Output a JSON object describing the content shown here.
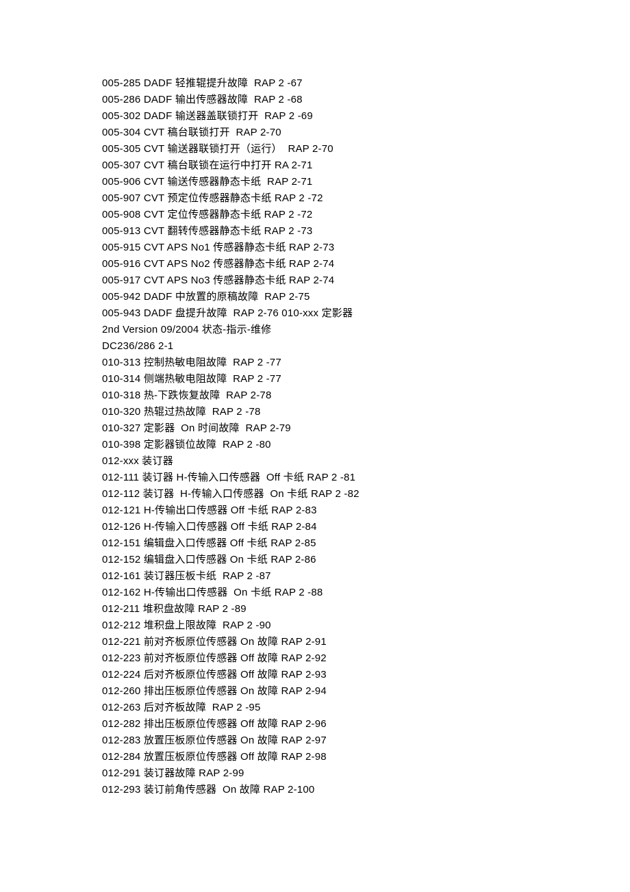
{
  "lines": [
    "005-285 DADF 轻推辊提升故障  RAP 2 -67",
    "005-286 DADF 输出传感器故障  RAP 2 -68",
    "005-302 DADF 输送器盖联锁打开  RAP 2 -69",
    "005-304 CVT 稿台联锁打开  RAP 2-70",
    "005-305 CVT 输送器联锁打开（运行）  RAP 2-70",
    "005-307 CVT 稿台联锁在运行中打开 RA 2-71",
    "005-906 CVT 输送传感器静态卡纸  RAP 2-71",
    "005-907 CVT 预定位传感器静态卡纸 RAP 2 -72",
    "005-908 CVT 定位传感器静态卡纸 RAP 2 -72",
    "005-913 CVT 翻转传感器静态卡纸 RAP 2 -73",
    "005-915 CVT APS No1 传感器静态卡纸 RAP 2-73",
    "005-916 CVT APS No2 传感器静态卡纸 RAP 2-74",
    "005-917 CVT APS No3 传感器静态卡纸 RAP 2-74",
    "005-942 DADF 中放置的原稿故障  RAP 2-75",
    "005-943 DADF 盘提升故障  RAP 2-76 010-xxx 定影器",
    "2nd Version 09/2004 状态-指示-维修",
    "DC236/286 2-1",
    "010-313 控制热敏电阻故障  RAP 2 -77",
    "010-314 侧端热敏电阻故障  RAP 2 -77",
    "010-318 热-下跌恢复故障  RAP 2-78",
    "010-320 热辊过热故障  RAP 2 -78",
    "010-327 定影器  On 时间故障  RAP 2-79",
    "010-398 定影器锁位故障  RAP 2 -80",
    "012-xxx 装订器",
    "012-111 装订器 H-传输入口传感器  Off 卡纸 RAP 2 -81",
    "012-112 装订器  H-传输入口传感器  On 卡纸 RAP 2 -82",
    "012-121 H-传输出口传感器 Off 卡纸 RAP 2-83",
    "012-126 H-传输入口传感器 Off 卡纸 RAP 2-84",
    "012-151 编辑盘入口传感器 Off 卡纸 RAP 2-85",
    "012-152 编辑盘入口传感器 On 卡纸 RAP 2-86",
    "012-161 装订器压板卡纸  RAP 2 -87",
    "012-162 H-传输出口传感器  On 卡纸 RAP 2 -88",
    "012-211 堆积盘故障 RAP 2 -89",
    "012-212 堆积盘上限故障  RAP 2 -90",
    "012-221 前对齐板原位传感器 On 故障 RAP 2-91",
    "012-223 前对齐板原位传感器 Off 故障 RAP 2-92",
    "012-224 后对齐板原位传感器 Off 故障 RAP 2-93",
    "012-260 排出压板原位传感器 On 故障 RAP 2-94",
    "012-263 后对齐板故障  RAP 2 -95",
    "012-282 排出压板原位传感器 Off 故障 RAP 2-96",
    "012-283 放置压板原位传感器 On 故障 RAP 2-97",
    "012-284 放置压板原位传感器 Off 故障 RAP 2-98",
    "012-291 装订器故障 RAP 2-99",
    "012-293 装订前角传感器  On 故障 RAP 2-100"
  ]
}
